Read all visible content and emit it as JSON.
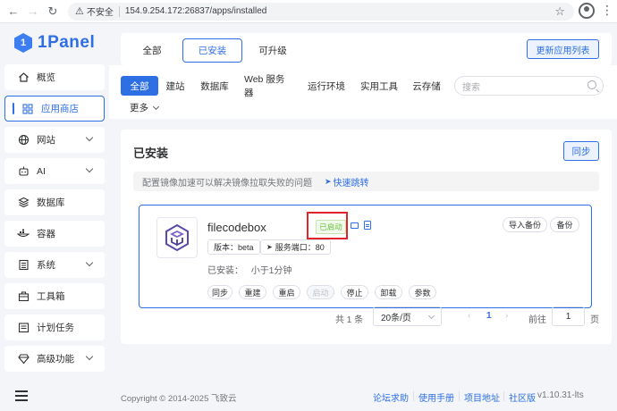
{
  "browser": {
    "back": "←",
    "forward": "→",
    "reload": "↻",
    "insecure_label": "不安全",
    "url": "154.9.254.172:26837/apps/installed"
  },
  "brand": {
    "logo_mark": "1",
    "name": "1Panel"
  },
  "sidebar": {
    "items": [
      {
        "label": "概览",
        "icon": "home-icon"
      },
      {
        "label": "应用商店",
        "icon": "apps-icon",
        "active": true
      },
      {
        "label": "网站",
        "icon": "globe-icon",
        "expandable": true
      },
      {
        "label": "AI",
        "icon": "robot-icon",
        "expandable": true
      },
      {
        "label": "数据库",
        "icon": "database-icon"
      },
      {
        "label": "容器",
        "icon": "container-icon"
      },
      {
        "label": "系统",
        "icon": "system-icon",
        "expandable": true
      },
      {
        "label": "工具箱",
        "icon": "toolbox-icon"
      },
      {
        "label": "计划任务",
        "icon": "schedule-icon"
      },
      {
        "label": "高级功能",
        "icon": "diamond-icon",
        "expandable": true
      }
    ]
  },
  "tabs": {
    "items": [
      "全部",
      "已安装",
      "可升级"
    ],
    "active": "已安装",
    "update_button": "更新应用列表"
  },
  "filters": {
    "chips": [
      "全部",
      "建站",
      "数据库",
      "Web 服务器",
      "运行环境",
      "实用工具",
      "云存储"
    ],
    "active": "全部",
    "search_placeholder": "搜索",
    "more_label": "更多"
  },
  "installed": {
    "title": "已安装",
    "sync_button": "同步",
    "mirror_tip": "配置镜像加速可以解决镜像拉取失败的问题",
    "mirror_link": "快速跳转",
    "app": {
      "name": "filecodebox",
      "status": "已启动",
      "version_tag": "版本：beta",
      "port_tag": "服务端口：80",
      "installed_label": "已安装：",
      "installed_time": "小于1分钟",
      "import_backup": "导入备份",
      "backup": "备份",
      "actions": [
        "同步",
        "重建",
        "重启",
        "启动",
        "停止",
        "卸载",
        "参数"
      ],
      "disabled_action": "启动"
    },
    "pagination": {
      "total": "共 1 条",
      "page_size": "20条/页",
      "current_page": "1",
      "goto_label": "前往",
      "goto_value": "1",
      "page_unit": "页"
    }
  },
  "footer": {
    "copyright": "Copyright © 2014-2025 飞致云",
    "links": [
      "论坛求助",
      "使用手册",
      "项目地址",
      "社区版"
    ],
    "version": "v1.10.31-lts"
  }
}
